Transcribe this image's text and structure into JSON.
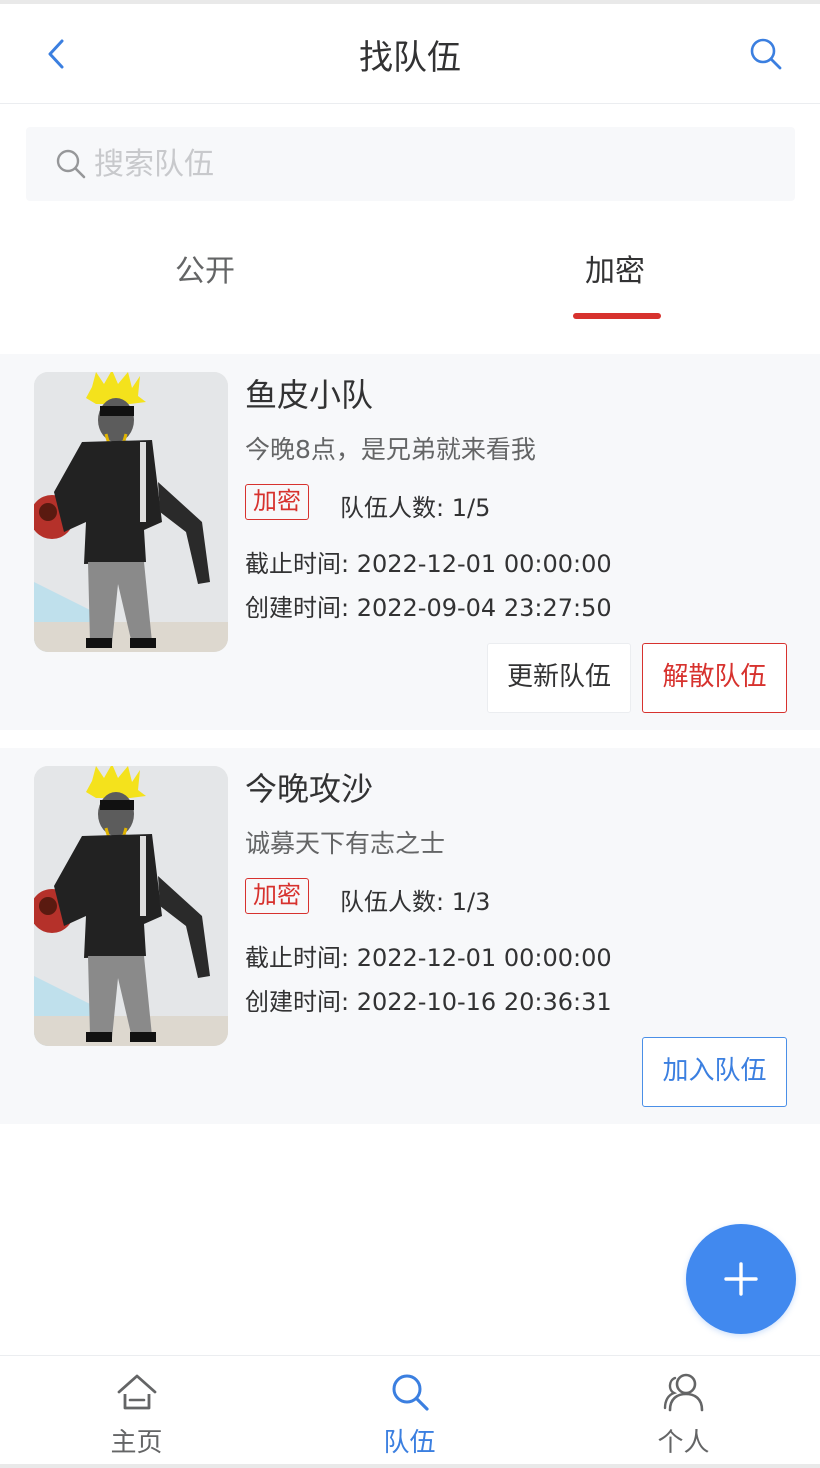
{
  "navbar": {
    "title": "找队伍"
  },
  "search": {
    "placeholder": "搜索队伍",
    "value": ""
  },
  "tabs": [
    {
      "label": "公开",
      "active": false
    },
    {
      "label": "加密",
      "active": true
    }
  ],
  "teams": [
    {
      "name": "鱼皮小队",
      "description": "今晚8点，是兄弟就来看我",
      "tag": "加密",
      "member_count": "队伍人数: 1/5",
      "expire_time": "截止时间: 2022-12-01 00:00:00",
      "create_time": "创建时间: 2022-09-04 23:27:50",
      "buttons": [
        "更新队伍",
        "解散队伍"
      ]
    },
    {
      "name": "今晚攻沙",
      "description": "诚募天下有志之士",
      "tag": "加密",
      "member_count": "队伍人数: 1/3",
      "expire_time": "截止时间: 2022-12-01 00:00:00",
      "create_time": "创建时间: 2022-10-16 20:36:31",
      "buttons": [
        "加入队伍"
      ]
    }
  ],
  "tabbar": [
    {
      "label": "主页",
      "icon": "home-icon",
      "active": false
    },
    {
      "label": "队伍",
      "icon": "search-icon",
      "active": true
    },
    {
      "label": "个人",
      "icon": "friends-icon",
      "active": false
    }
  ],
  "colors": {
    "accent": "#3b7fe0",
    "danger": "#d7322e",
    "fab": "#4189ef",
    "card_bg": "#f7f8fa"
  }
}
